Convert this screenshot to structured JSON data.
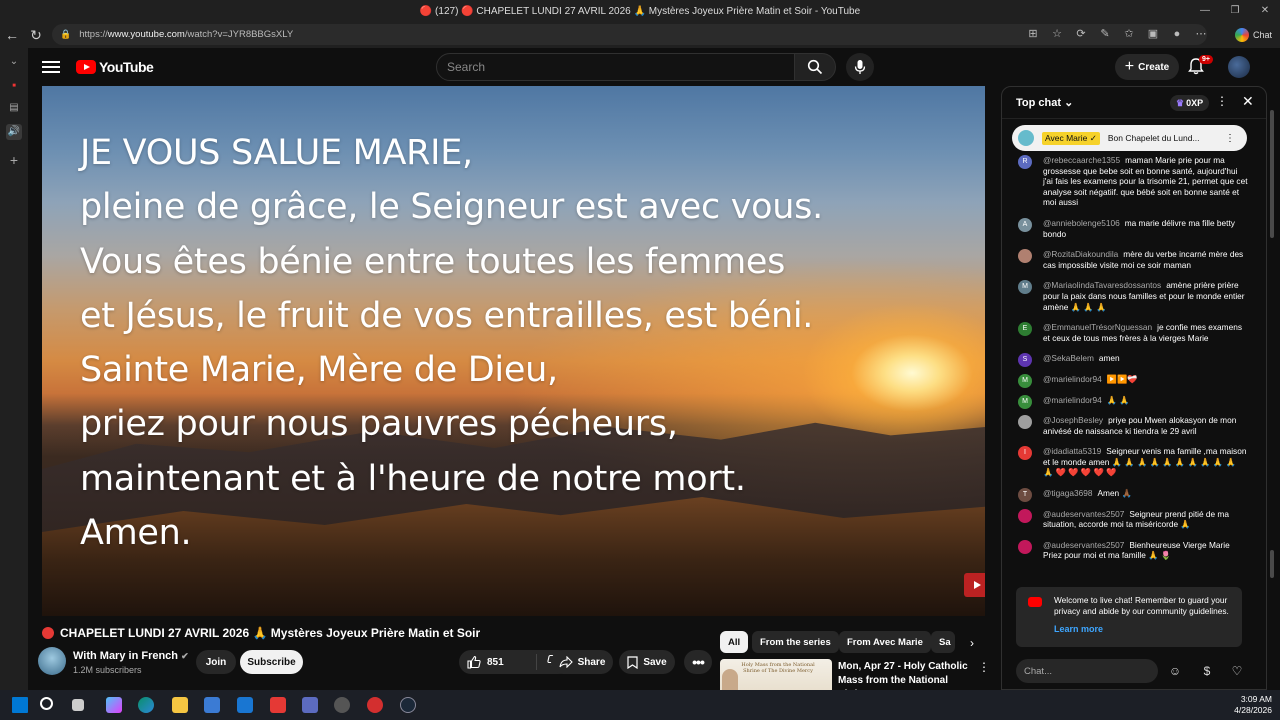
{
  "window": {
    "title": "🔴 (127) 🔴 CHAPELET LUNDI 27 AVRIL 2026 🙏 Mystères Joyeux Prière Matin et Soir - YouTube",
    "url_scheme": "https://",
    "url_host": "www.youtube.com",
    "url_path": "/watch?v=JYR8BBGsXLY",
    "chat_label": "Chat"
  },
  "header": {
    "logo_text": "YouTube",
    "search_placeholder": "Search",
    "create_label": "Create",
    "notif_count": "9+"
  },
  "video": {
    "lyrics": [
      "JE VOUS SALUE MARIE,",
      "pleine de grâce, le Seigneur est avec vous.",
      "Vous êtes bénie  entre toutes les femmes",
      "et Jésus, le fruit de vos entrailles, est béni.",
      "Sainte Marie, Mère de Dieu,",
      "priez pour nous pauvres pécheurs,",
      "maintenant et à l'heure de notre mort.",
      "Amen."
    ],
    "title": "CHAPELET LUNDI 27 AVRIL 2026 🙏 Mystères Joyeux Prière Matin et Soir"
  },
  "channel": {
    "name": "With Mary in French",
    "subscribers": "1.2M subscribers",
    "join_label": "Join",
    "subscribe_label": "Subscribe"
  },
  "actions": {
    "likes": "851",
    "share_label": "Share",
    "save_label": "Save"
  },
  "chips": [
    "All",
    "From the series",
    "From Avec Marie",
    "Sa"
  ],
  "recommendation": {
    "thumb_text": "Holy Mass from the National Shrine of The Divine Mercy",
    "title": "Mon, Apr 27 - Holy Catholic Mass from the National Shrine..."
  },
  "chat": {
    "header": "Top chat",
    "xp": "0XP",
    "pinned_author": "Avec Marie ✓",
    "pinned_text": "Bon Chapelet du Lund...",
    "messages": [
      {
        "initial": "R",
        "color": "#5c6bc0",
        "author": "@rebeccaarche1355",
        "text": "maman Marie prie pour ma grossesse que bebe soit en bonne santé, aujourd'hui j'ai fais les examens pour la trisomie 21, permet que cet analyse soit négatiif. que bébé soit en bonne santé et moi aussi"
      },
      {
        "initial": "A",
        "color": "#78909c",
        "author": "@anniebolenge5106",
        "text": "ma marie délivre ma fille betty bondo"
      },
      {
        "initial": "",
        "color": "#b08070",
        "author": "@RozitaDiakoundila",
        "text": "mère du verbe incarné mère des cas impossible visite moi ce soir maman"
      },
      {
        "initial": "M",
        "color": "#607d8b",
        "author": "@MariaolindaTavaresdossantos",
        "text": "amène prière prière pour la paix dans nous familles et pour le monde entier amène 🙏 🙏 🙏"
      },
      {
        "initial": "E",
        "color": "#2e7d32",
        "author": "@EmmanuelTrésorNguessan",
        "text": "je confie mes examens et ceux de tous mes frères à la vierges Marie"
      },
      {
        "initial": "S",
        "color": "#5e35b1",
        "author": "@SekaBelem",
        "text": "amen"
      },
      {
        "initial": "M",
        "color": "#388e3c",
        "author": "@marielindor94",
        "text": "▶️▶️❤️‍🩹"
      },
      {
        "initial": "M",
        "color": "#388e3c",
        "author": "@marielindor94",
        "text": "🙏 🙏"
      },
      {
        "initial": "",
        "color": "#9e9e9e",
        "author": "@JosephBesley",
        "text": "priye pou Mwen alokasyon de mon anivésé de naissance ki tiendra le 29 avril"
      },
      {
        "initial": "I",
        "color": "#e53935",
        "author": "@idadiatta5319",
        "text": "Seigneur venis ma famille ,ma maison et le monde amen 🙏 🙏 🙏 🙏 🙏 🙏 🙏 🙏 🙏 🙏 🙏 ❤️ ❤️ ❤️ ❤️ ❤️"
      },
      {
        "initial": "T",
        "color": "#6d4c41",
        "author": "@tigaga3698",
        "text": "Amen 🙏🏾"
      },
      {
        "initial": "",
        "color": "#c2185b",
        "author": "@audeservantes2507",
        "text": "Seigneur prend pitié de ma situation, accorde moi ta miséricorde 🙏"
      },
      {
        "initial": "",
        "color": "#c2185b",
        "author": "@audeservantes2507",
        "text": "Bienheureuse Vierge Marie Priez pour moi et ma famille 🙏 🌷"
      }
    ],
    "welcome_text": "Welcome to live chat! Remember to guard your privacy and abide by our community guidelines.",
    "learn_more": "Learn more",
    "input_placeholder": "Chat..."
  },
  "taskbar": {
    "time": "3:09 AM",
    "date": "4/28/2026"
  }
}
